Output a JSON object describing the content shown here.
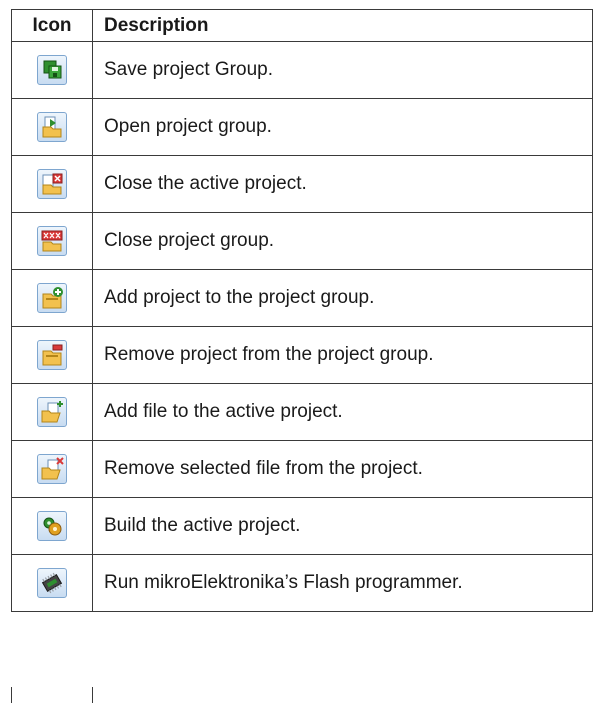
{
  "table": {
    "headers": {
      "icon": "Icon",
      "description": "Description"
    },
    "rows": [
      {
        "icon": "save-project-group-icon",
        "description": "Save project Group."
      },
      {
        "icon": "open-project-group-icon",
        "description": "Open project group."
      },
      {
        "icon": "close-active-project-icon",
        "description": "Close the active project."
      },
      {
        "icon": "close-project-group-icon",
        "description": "Close project group."
      },
      {
        "icon": "add-project-icon",
        "description": "Add project to the project group."
      },
      {
        "icon": "remove-project-icon",
        "description": "Remove project from the project group."
      },
      {
        "icon": "add-file-icon",
        "description": "Add file to the active project."
      },
      {
        "icon": "remove-file-icon",
        "description": "Remove selected file from the project."
      },
      {
        "icon": "build-project-icon",
        "description": "Build the active project."
      },
      {
        "icon": "flash-programmer-icon",
        "description": "Run mikroElektronika’s Flash programmer."
      }
    ]
  },
  "colors": {
    "border": "#3a3a3a",
    "icon_frame": "#7ea6cf",
    "folder": "#f2c14e",
    "green": "#2f8f2f",
    "red": "#d93a3a"
  }
}
